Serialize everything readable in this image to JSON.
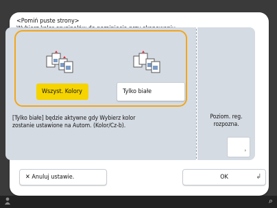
{
  "dialog": {
    "title": "<Pomiń puste strony>",
    "subtitle": "Wybierz kolor oryginałów do pominięcia przy skanowaniu."
  },
  "options": [
    {
      "label": "Wszyst. Kolory",
      "icon": "color-pages-icon",
      "selected": true
    },
    {
      "label": "Tylko białe",
      "icon": "white-pages-icon",
      "selected": false
    }
  ],
  "info_lines": [
    "[Tylko białe] będzie aktywne gdy Wybierz kolor",
    "zostanie ustawione na Autom. (Kolor/Cz-b)."
  ],
  "side": {
    "label_lines": [
      "Poziom. reg.",
      "rozpozna."
    ],
    "button_mark": "›"
  },
  "buttons": {
    "cancel": "✕ Anuluj ustawie.",
    "ok": "OK",
    "ok_corner": "↲"
  },
  "statusbar": {
    "left_icon": "user-icon",
    "right_icon": "status-monitor-icon",
    "right_glyph": "⌕"
  },
  "colors": {
    "accent_selected": "#f5d400",
    "highlight_border": "#f2a51a",
    "panel_bg": "#d5dbe3"
  }
}
